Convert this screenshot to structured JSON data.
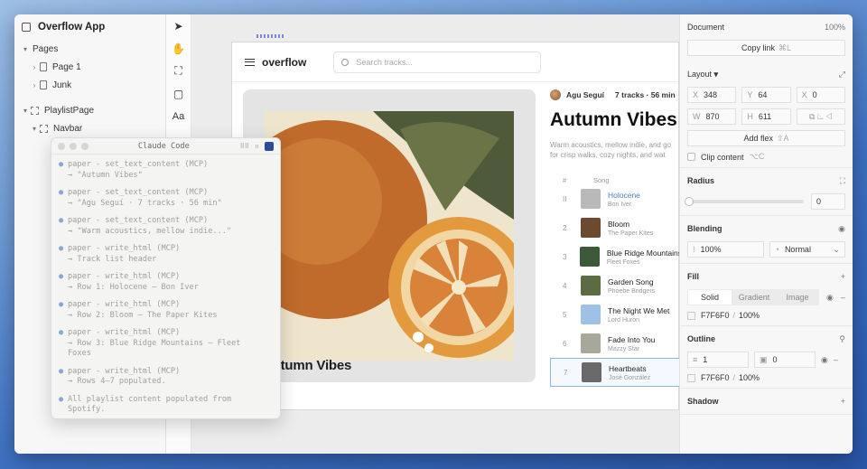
{
  "app": {
    "title": "Overflow App"
  },
  "layers": {
    "pages_label": "Pages",
    "pages": [
      "Page 1",
      "Junk"
    ],
    "playlist_page": "PlaylistPage",
    "navbar": "Navbar"
  },
  "canvas": {
    "brand": "overflow",
    "search_placeholder": "Search tracks...",
    "cover_title": "Autumn Vibes",
    "author": "Agu Seguí",
    "stats": "7 tracks · 56 min",
    "playlist_title": "Autumn Vibes",
    "description_1": "Warm acoustics, mellow indie, and go",
    "description_2": "for crisp walks, cozy nights, and wat",
    "col_num": "#",
    "col_song": "Song",
    "tracks": [
      {
        "num": "II",
        "name": "Holocene",
        "artist": "Bon Iver",
        "color": "#b9b9b9"
      },
      {
        "num": "2",
        "name": "Bloom",
        "artist": "The Paper Kites",
        "color": "#6b4a2e"
      },
      {
        "num": "3",
        "name": "Blue Ridge Mountains",
        "artist": "Fleet Foxes",
        "color": "#3c5a3a"
      },
      {
        "num": "4",
        "name": "Garden Song",
        "artist": "Phoebe Bridgers",
        "color": "#5c6b42"
      },
      {
        "num": "5",
        "name": "The Night We Met",
        "artist": "Lord Huron",
        "color": "#9ec2e6"
      },
      {
        "num": "6",
        "name": "Fade Into You",
        "artist": "Mazzy Star",
        "color": "#a7a79a"
      },
      {
        "num": "7",
        "name": "Heartbeats",
        "artist": "José González",
        "color": "#6a6a6a"
      }
    ]
  },
  "inspector": {
    "document": "Document",
    "zoom": "100%",
    "copy_link": "Copy link",
    "copy_shortcut": "⌘L",
    "layout": "Layout",
    "x": "348",
    "y": "64",
    "r": "0",
    "w": "870",
    "h": "611",
    "add_flex": "Add flex",
    "add_flex_shortcut": "⇧A",
    "clip": "Clip content",
    "clip_shortcut": "⌥C",
    "radius": "Radius",
    "radius_value": "0",
    "blending": "Blending",
    "opacity": "100%",
    "blend_mode": "Normal",
    "fill": "Fill",
    "fill_tabs": [
      "Solid",
      "Gradient",
      "Image"
    ],
    "fill_hex": "F7F6F0",
    "fill_opacity": "100%",
    "outline": "Outline",
    "outline_width": "1",
    "outline_radius": "0",
    "outline_hex": "F7F6F0",
    "outline_opacity": "100%",
    "shadow": "Shadow"
  },
  "claude": {
    "title": "Claude Code",
    "entries": [
      {
        "cmd": "paper - set_text_content (MCP)",
        "detail": "→ \"Autumn Vibes\""
      },
      {
        "cmd": "paper - set_text_content (MCP)",
        "detail": "→ \"Agu Seguí · 7 tracks · 56 min\""
      },
      {
        "cmd": "paper - set_text_content (MCP)",
        "detail": "→ \"Warm acoustics, mellow indie...\""
      },
      {
        "cmd": "paper - write_html (MCP)",
        "detail": "→ Track list header"
      },
      {
        "cmd": "paper - write_html (MCP)",
        "detail": "→ Row 1: Holocene — Bon Iver"
      },
      {
        "cmd": "paper - write_html (MCP)",
        "detail": "→ Row 2: Bloom — The Paper Kites"
      },
      {
        "cmd": "paper - write_html (MCP)",
        "detail": "→ Row 3: Blue Ridge Mountains — Fleet\nFoxes"
      },
      {
        "cmd": "paper - write_html (MCP)",
        "detail": "→ Rows 4–7 populated."
      },
      {
        "cmd": "All playlist content populated from",
        "detail": "Spotify."
      }
    ]
  }
}
